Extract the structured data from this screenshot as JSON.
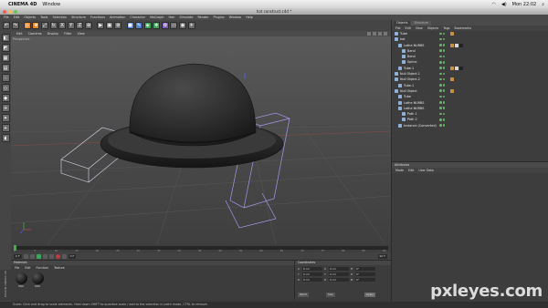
{
  "mac_menubar": {
    "app_name": "CINEMA 4D",
    "menus": [
      "Window"
    ],
    "clock": "Mon 22:02"
  },
  "window": {
    "title": "hat construct.c4d *"
  },
  "app_menu": [
    "File",
    "Edit",
    "Objects",
    "Tools",
    "Selection",
    "Structure",
    "Functions",
    "Animation",
    "Character",
    "MoGraph",
    "Hair",
    "Simulate",
    "Render",
    "Plugins",
    "Window",
    "Help"
  ],
  "toolbar": {
    "buttons": [
      {
        "icon": "undo-icon",
        "glyph": "↶",
        "color": "gray"
      },
      {
        "icon": "redo-icon",
        "glyph": "↷",
        "color": "gray"
      },
      {
        "icon": "live-selection-icon",
        "glyph": "◎",
        "color": "orange"
      },
      {
        "icon": "move-icon",
        "glyph": "✥",
        "color": "orange"
      },
      {
        "icon": "scale-icon",
        "glyph": "⤢",
        "color": "gray"
      },
      {
        "icon": "rotate-icon",
        "glyph": "↻",
        "color": "gray"
      },
      {
        "icon": "x-axis-icon",
        "glyph": "X",
        "color": "gray"
      },
      {
        "icon": "y-axis-icon",
        "glyph": "Y",
        "color": "gray"
      },
      {
        "icon": "z-axis-icon",
        "glyph": "Z",
        "color": "gray"
      },
      {
        "icon": "coordinate-system-icon",
        "glyph": "⊕",
        "color": "gray"
      },
      {
        "icon": "render-view-icon",
        "glyph": "▶",
        "color": "gray"
      },
      {
        "icon": "render-picture-icon",
        "glyph": "▣",
        "color": "gray"
      },
      {
        "icon": "render-settings-icon",
        "glyph": "⚙",
        "color": "gray"
      },
      {
        "icon": "cube-icon",
        "glyph": "■",
        "color": "blue"
      },
      {
        "icon": "pen-icon",
        "glyph": "✎",
        "color": "blue"
      },
      {
        "icon": "nurbs-icon",
        "glyph": "◈",
        "color": "green"
      },
      {
        "icon": "array-icon",
        "glyph": "❖",
        "color": "green"
      },
      {
        "icon": "deformer-icon",
        "glyph": "✿",
        "color": "purple"
      },
      {
        "icon": "floor-icon",
        "glyph": "▭",
        "color": "gray"
      },
      {
        "icon": "camera-icon",
        "glyph": "◉",
        "color": "gray"
      },
      {
        "icon": "light-icon",
        "glyph": "☀",
        "color": "gray"
      }
    ]
  },
  "left_tools": [
    {
      "icon": "model-mode-icon",
      "glyph": "◧"
    },
    {
      "icon": "object-mode-icon",
      "glyph": "◩"
    },
    {
      "icon": "texture-mode-icon",
      "glyph": "▦"
    },
    {
      "icon": "workplane-icon",
      "glyph": "▤"
    },
    {
      "icon": "points-mode-icon",
      "glyph": "⁘"
    },
    {
      "icon": "edges-mode-icon",
      "glyph": "◇"
    },
    {
      "icon": "polygons-mode-icon",
      "glyph": "◆"
    },
    {
      "icon": "axis-icon",
      "glyph": "✛"
    },
    {
      "icon": "tweak-icon",
      "glyph": "✦"
    },
    {
      "icon": "snap-icon",
      "glyph": "⌖"
    },
    {
      "icon": "magnet-icon",
      "glyph": "◖"
    }
  ],
  "viewport": {
    "menu": [
      "Edit",
      "Cameras",
      "Display",
      "Filter",
      "View"
    ],
    "label": "Perspective"
  },
  "object_manager": {
    "tabs": [
      "Objects",
      "Structure"
    ],
    "menu": [
      "File",
      "Edit",
      "View",
      "Objects",
      "Tags",
      "Bookmarks"
    ],
    "rows": [
      {
        "name": "Tube",
        "depth": 0,
        "tags": [
          "#c9903f"
        ]
      },
      {
        "name": "hat",
        "depth": 0,
        "tags": []
      },
      {
        "name": "Lathe NURBS",
        "depth": 1,
        "tags": [
          "#c9903f",
          "#d8d8d8",
          "#222222"
        ]
      },
      {
        "name": "Bend",
        "depth": 2,
        "tags": []
      },
      {
        "name": "Bend",
        "depth": 2,
        "tags": []
      },
      {
        "name": "Spline",
        "depth": 2,
        "tags": []
      },
      {
        "name": "Tube.1",
        "depth": 1,
        "tags": [
          "#c9903f",
          "#d8d8d8",
          "#222222"
        ]
      },
      {
        "name": "Null Object.1",
        "depth": 0,
        "tags": []
      },
      {
        "name": "Null Object.2",
        "depth": 0,
        "tags": [
          "#c9903f"
        ]
      },
      {
        "name": "Tube.1",
        "depth": 1,
        "tags": []
      },
      {
        "name": "Null Object",
        "depth": 0,
        "tags": [
          "#c9903f"
        ]
      },
      {
        "name": "Tube",
        "depth": 1,
        "tags": []
      },
      {
        "name": "Lathe NURBS",
        "depth": 1,
        "tags": []
      },
      {
        "name": "Lathe NURBS",
        "depth": 1,
        "tags": []
      },
      {
        "name": "Path 1",
        "depth": 2,
        "tags": []
      },
      {
        "name": "Path 2",
        "depth": 2,
        "tags": []
      },
      {
        "name": "Instance (Converted)",
        "depth": 1,
        "tags": []
      }
    ]
  },
  "attribute_manager": {
    "title": "Attributes",
    "menu": [
      "Mode",
      "Edit",
      "User Data"
    ]
  },
  "timeline": {
    "ticks": [
      "0",
      "5",
      "10",
      "15",
      "20",
      "25",
      "30",
      "35",
      "40",
      "45",
      "50",
      "55",
      "60",
      "65",
      "70",
      "75",
      "80",
      "85",
      "90"
    ],
    "start": "0 F",
    "end": "90 F",
    "current": "0 F"
  },
  "material_manager": {
    "title": "Materials",
    "menu": [
      "File",
      "Edit",
      "Function",
      "Texture"
    ],
    "materials": [
      "Mat",
      "Mat"
    ]
  },
  "coordinates": {
    "title": "Coordinates",
    "rows": [
      {
        "a": "X",
        "av": "0 cm",
        "b": "X",
        "bv": "0 cm",
        "c": "H",
        "cv": "0°"
      },
      {
        "a": "Y",
        "av": "0 cm",
        "b": "Y",
        "bv": "0 cm",
        "c": "P",
        "cv": "0°"
      },
      {
        "a": "Z",
        "av": "0 cm",
        "b": "Z",
        "bv": "0 cm",
        "c": "B",
        "cv": "0°"
      }
    ],
    "mode": "World",
    "size_mode": "Size",
    "apply": "Apply"
  },
  "statusbar": "Scale: Click and drag to scale elements. Hold down SHIFT to quantize scale / add to the selection in point mode, CTRL to remove.",
  "side_label": "MAXON CINEMA 4D",
  "watermark": "pxleyes.com"
}
